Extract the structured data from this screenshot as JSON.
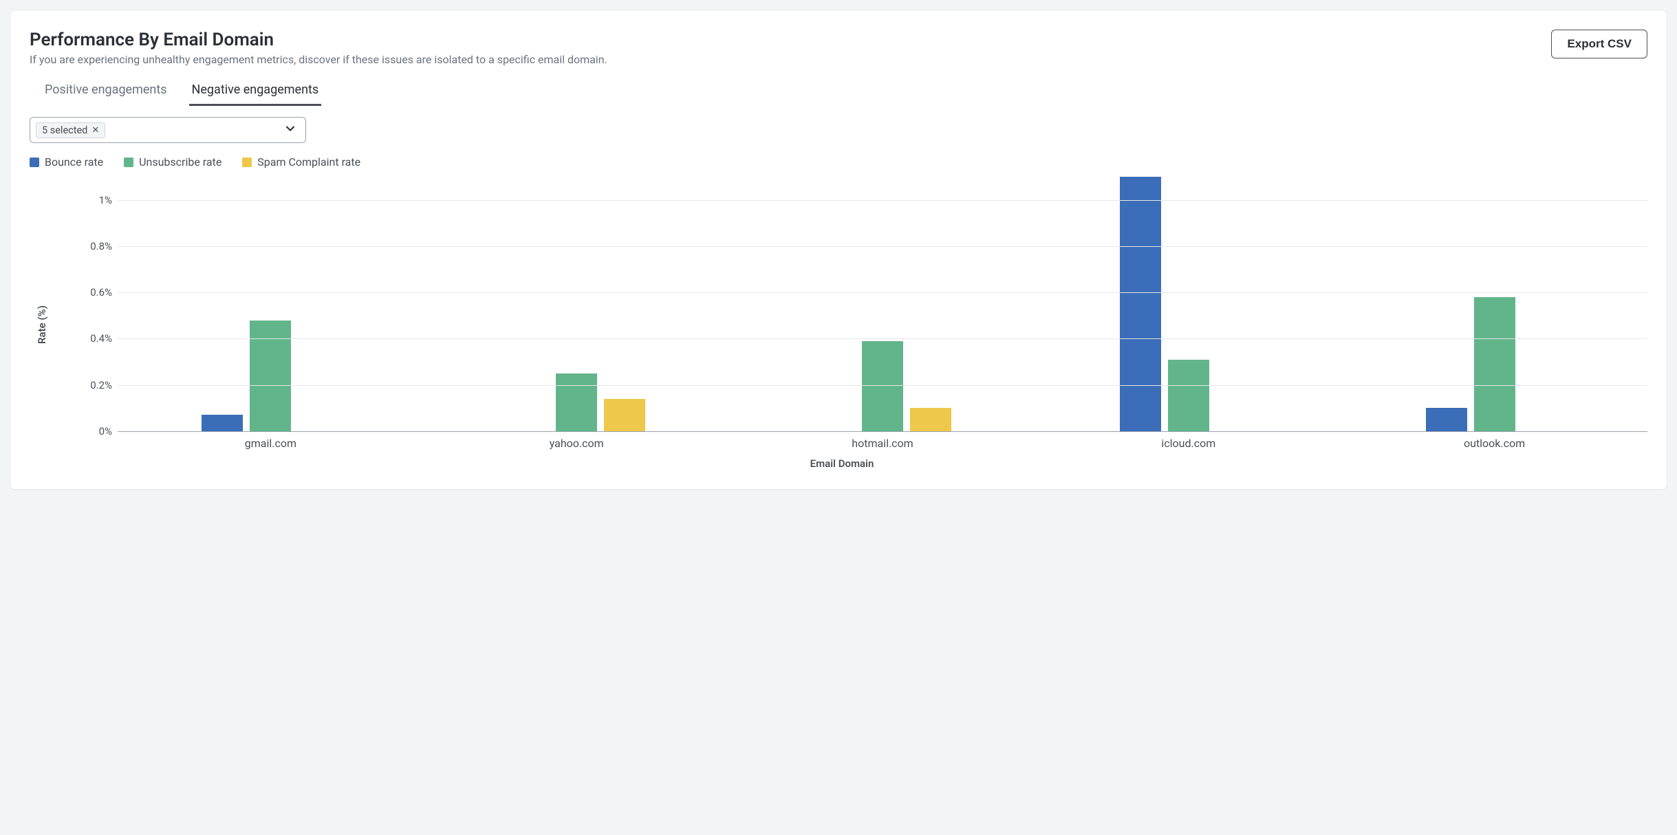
{
  "header": {
    "title": "Performance By Email Domain",
    "subtitle": "If you are experiencing unhealthy engagement metrics, discover if these issues are isolated to a specific email domain.",
    "export_label": "Export CSV"
  },
  "tabs": {
    "positive": "Positive engagements",
    "negative": "Negative engagements",
    "active": "negative"
  },
  "filter": {
    "chip_label": "5 selected"
  },
  "legend": {
    "bounce": "Bounce rate",
    "unsub": "Unsubscribe rate",
    "spam": "Spam Complaint rate"
  },
  "axes": {
    "ylabel": "Rate (%)",
    "xlabel": "Email Domain",
    "yticks": [
      "0%",
      "0.2%",
      "0.4%",
      "0.6%",
      "0.8%",
      "1%"
    ]
  },
  "colors": {
    "bounce": "#3b6db8",
    "unsub": "#62b58a",
    "spam": "#edc84a"
  },
  "chart_data": {
    "type": "bar",
    "title": "Performance By Email Domain",
    "xlabel": "Email Domain",
    "ylabel": "Rate (%)",
    "ylim": [
      0,
      1.1
    ],
    "yticks": [
      0,
      0.2,
      0.4,
      0.6,
      0.8,
      1.0
    ],
    "categories": [
      "gmail.com",
      "yahoo.com",
      "hotmail.com",
      "icloud.com",
      "outlook.com"
    ],
    "series": [
      {
        "name": "Bounce rate",
        "key": "bounce",
        "values": [
          0.07,
          0.0,
          0.0,
          1.1,
          0.1
        ]
      },
      {
        "name": "Unsubscribe rate",
        "key": "unsub",
        "values": [
          0.48,
          0.25,
          0.39,
          0.31,
          0.58
        ]
      },
      {
        "name": "Spam Complaint rate",
        "key": "spam",
        "values": [
          0.0,
          0.14,
          0.1,
          0.0,
          0.0
        ]
      }
    ],
    "legend_position": "top-left",
    "grid": true
  }
}
